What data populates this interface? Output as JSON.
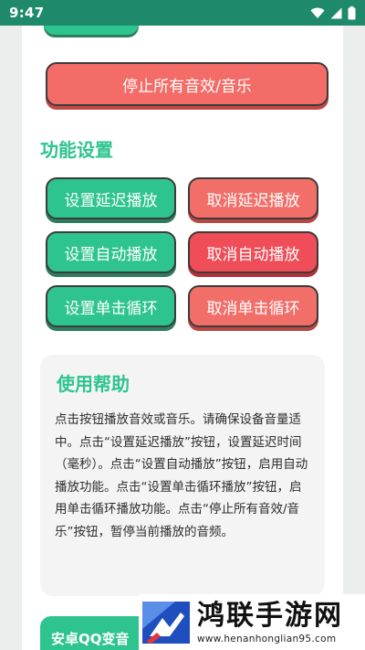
{
  "status_bar": {
    "time": "9:47"
  },
  "buttons": {
    "stop_all": "停止所有音效/音乐"
  },
  "features": {
    "title": "功能设置",
    "items": [
      {
        "label": "设置延迟播放",
        "color": "#2ec48f"
      },
      {
        "label": "取消延迟播放",
        "color": "#f26f69"
      },
      {
        "label": "设置自动播放",
        "color": "#2ec48f"
      },
      {
        "label": "取消自动播放",
        "color": "#ef4d57"
      },
      {
        "label": "设置单击循环",
        "color": "#2ec48f"
      },
      {
        "label": "取消单击循环",
        "color": "#f26f69"
      }
    ]
  },
  "help": {
    "title": "使用帮助",
    "text": "点击按钮播放音效或音乐。请确保设备音量适中。点击“设置延迟播放”按钮，设置延迟时间（毫秒）。点击“设置自动播放”按钮，启用自动播放功能。点击“设置单击循环播放”按钮，启用单击循环播放功能。点击“停止所有音效/音乐”按钮，暂停当前播放的音频。"
  },
  "bottom_card": {
    "label": "安卓QQ变音"
  },
  "watermark": {
    "name": "鸿联手游网",
    "url": "www.henanhonglian95.com"
  },
  "colors": {
    "accent": "#2ec48f",
    "status_bar": "#1f8a6b",
    "danger": "#ef4d57",
    "salmon": "#f26f69"
  }
}
